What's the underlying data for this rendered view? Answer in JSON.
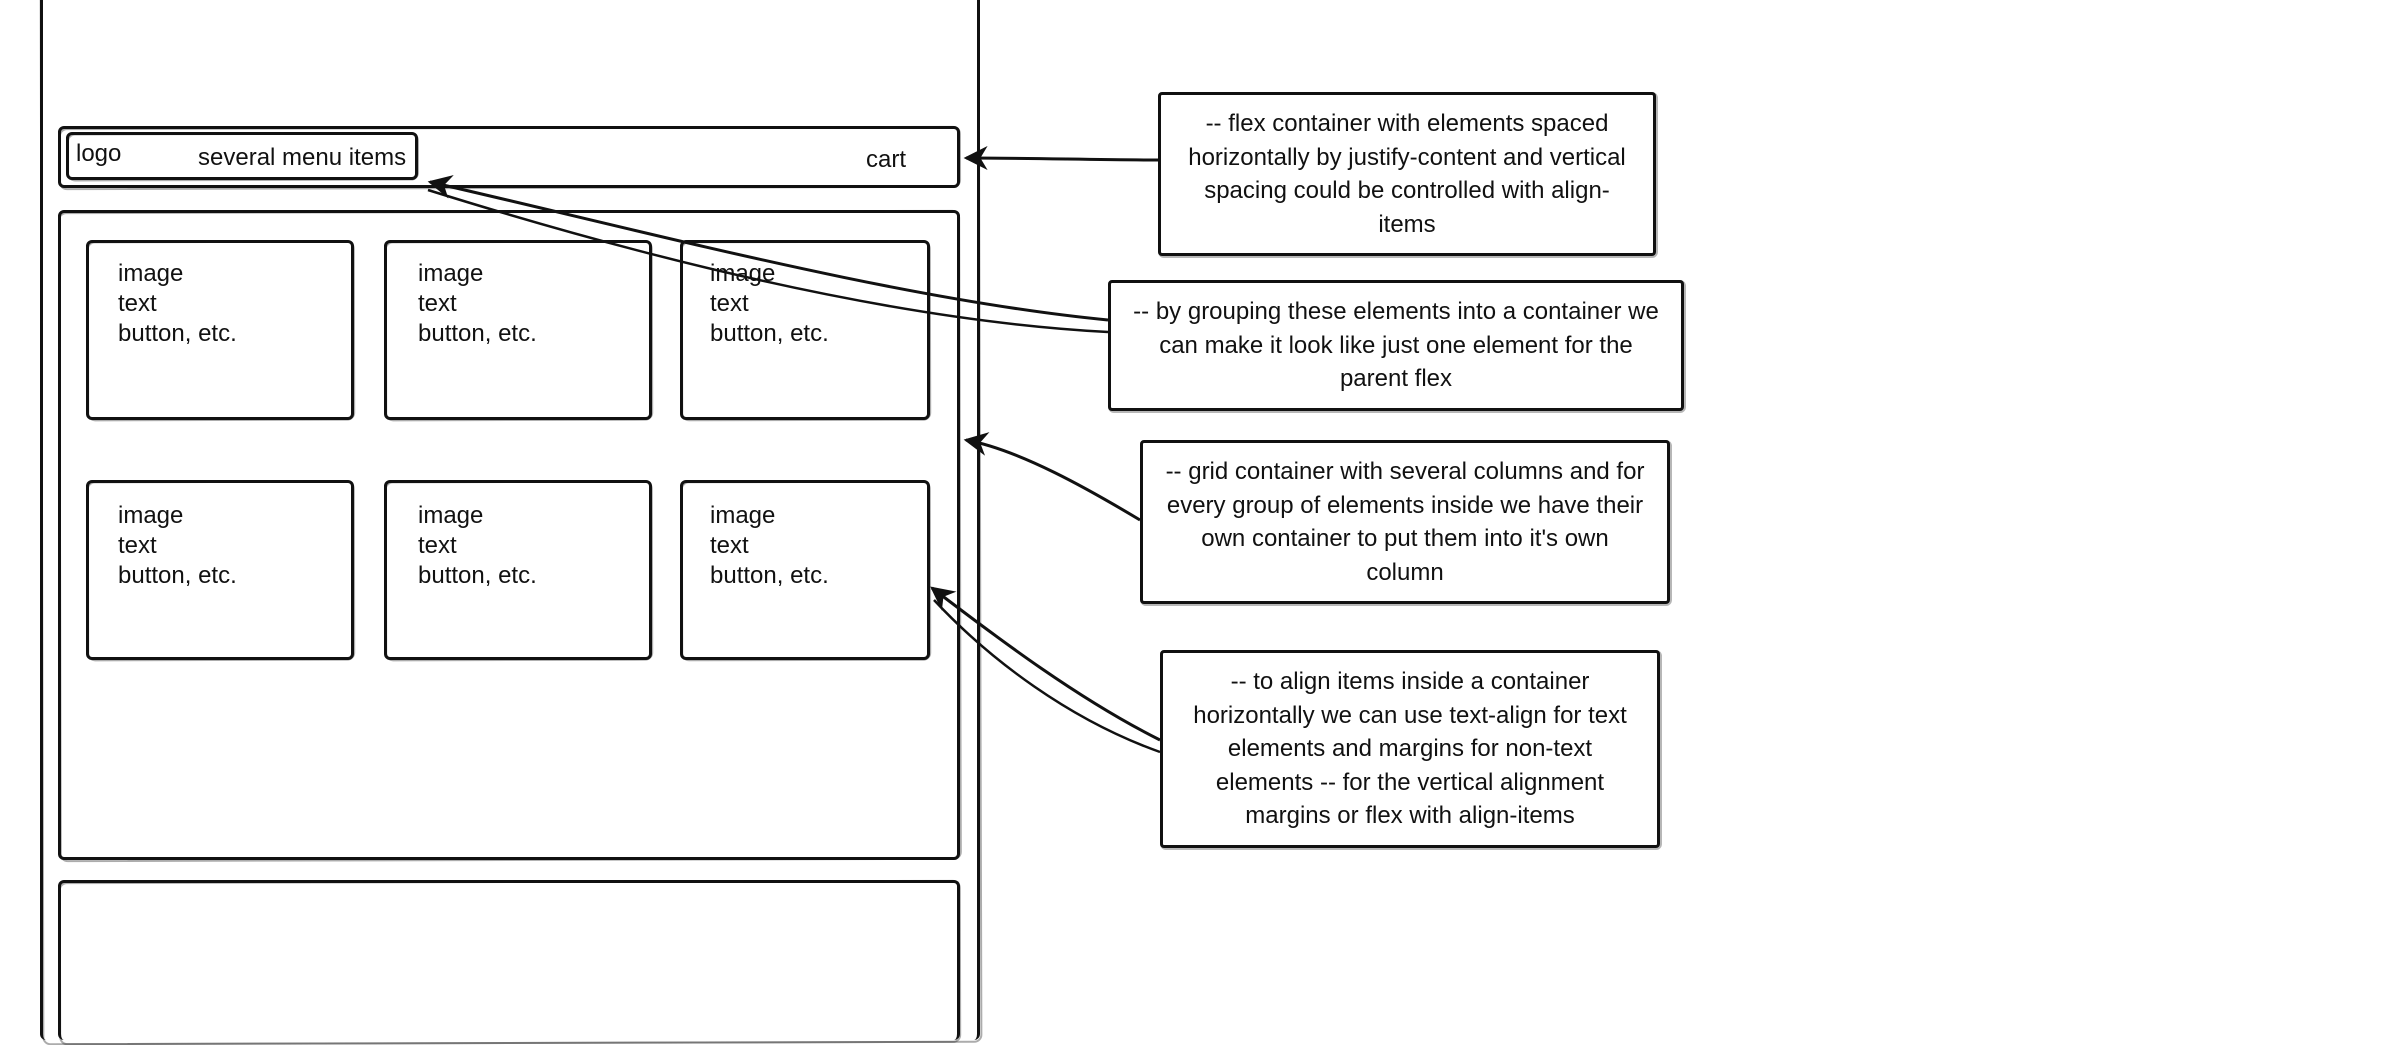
{
  "browser": {
    "header": {
      "logo": "logo",
      "menu": "several menu items",
      "cart": "cart"
    },
    "cards": [
      {
        "line1": "image",
        "line2": "text",
        "line3": "button, etc."
      },
      {
        "line1": "image",
        "line2": "text",
        "line3": "button, etc."
      },
      {
        "line1": "image",
        "line2": "text",
        "line3": "button, etc."
      },
      {
        "line1": "image",
        "line2": "text",
        "line3": "button, etc."
      },
      {
        "line1": "image",
        "line2": "text",
        "line3": "button, etc."
      },
      {
        "line1": "image",
        "line2": "text",
        "line3": "button, etc."
      }
    ]
  },
  "annotations": [
    {
      "text": "-- flex container with elements\nspaced horizontally by justify-content\nand vertical spacing could be\ncontrolled with align-items"
    },
    {
      "text": "-- by grouping these elements into a container\nwe can make it look like just\none element for the parent flex"
    },
    {
      "text": "-- grid container with several columns\nand for every group of elements\ninside we have their own container\nto put them into it's own column"
    },
    {
      "text": "-- to align items inside a container\nhorizontally we can use text-align\nfor text elements and margins\nfor non-text elements\n-- for the vertical alignment margins\nor flex with align-items"
    }
  ]
}
